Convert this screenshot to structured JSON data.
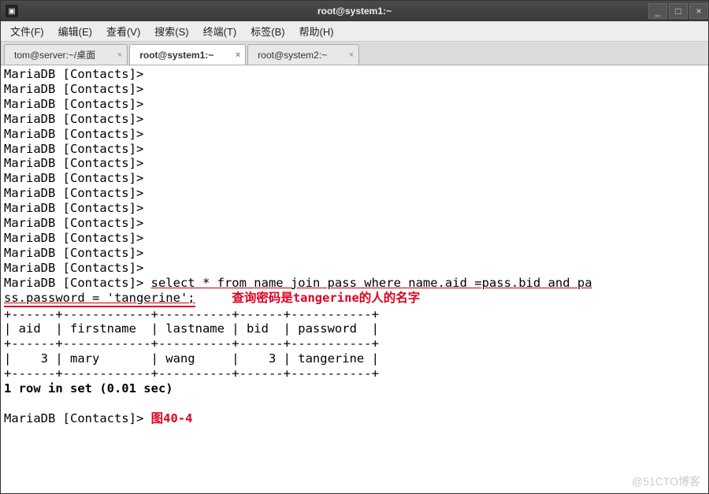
{
  "window": {
    "title": "root@system1:~",
    "controls": {
      "minimize": "_",
      "maximize": "□",
      "close": "×"
    }
  },
  "menubar": {
    "items": [
      "文件(F)",
      "编辑(E)",
      "查看(V)",
      "搜索(S)",
      "终端(T)",
      "标签(B)",
      "帮助(H)"
    ]
  },
  "tabs": [
    {
      "label": "tom@server:~/桌面",
      "active": false
    },
    {
      "label": "root@system1:~",
      "active": true
    },
    {
      "label": "root@system2:~",
      "active": false
    }
  ],
  "terminal": {
    "prompt": "MariaDB [Contacts]>",
    "blank_prompts": 14,
    "sql_part1": "select * from name join pass where name.aid =pass.bid and pa",
    "sql_part2": "ss.password = 'tangerine';",
    "annotation": "查询密码是tangerine的人的名字",
    "table_border": "+------+------------+----------+------+-----------+",
    "table_header": "| aid  | firstname  | lastname | bid  | password  |",
    "table_row": "|    3 | mary       | wang     |    3 | tangerine |",
    "result_msg": "1 row in set (0.01 sec)",
    "figure_label": "图40-4"
  },
  "watermark": "@51CTO博客"
}
